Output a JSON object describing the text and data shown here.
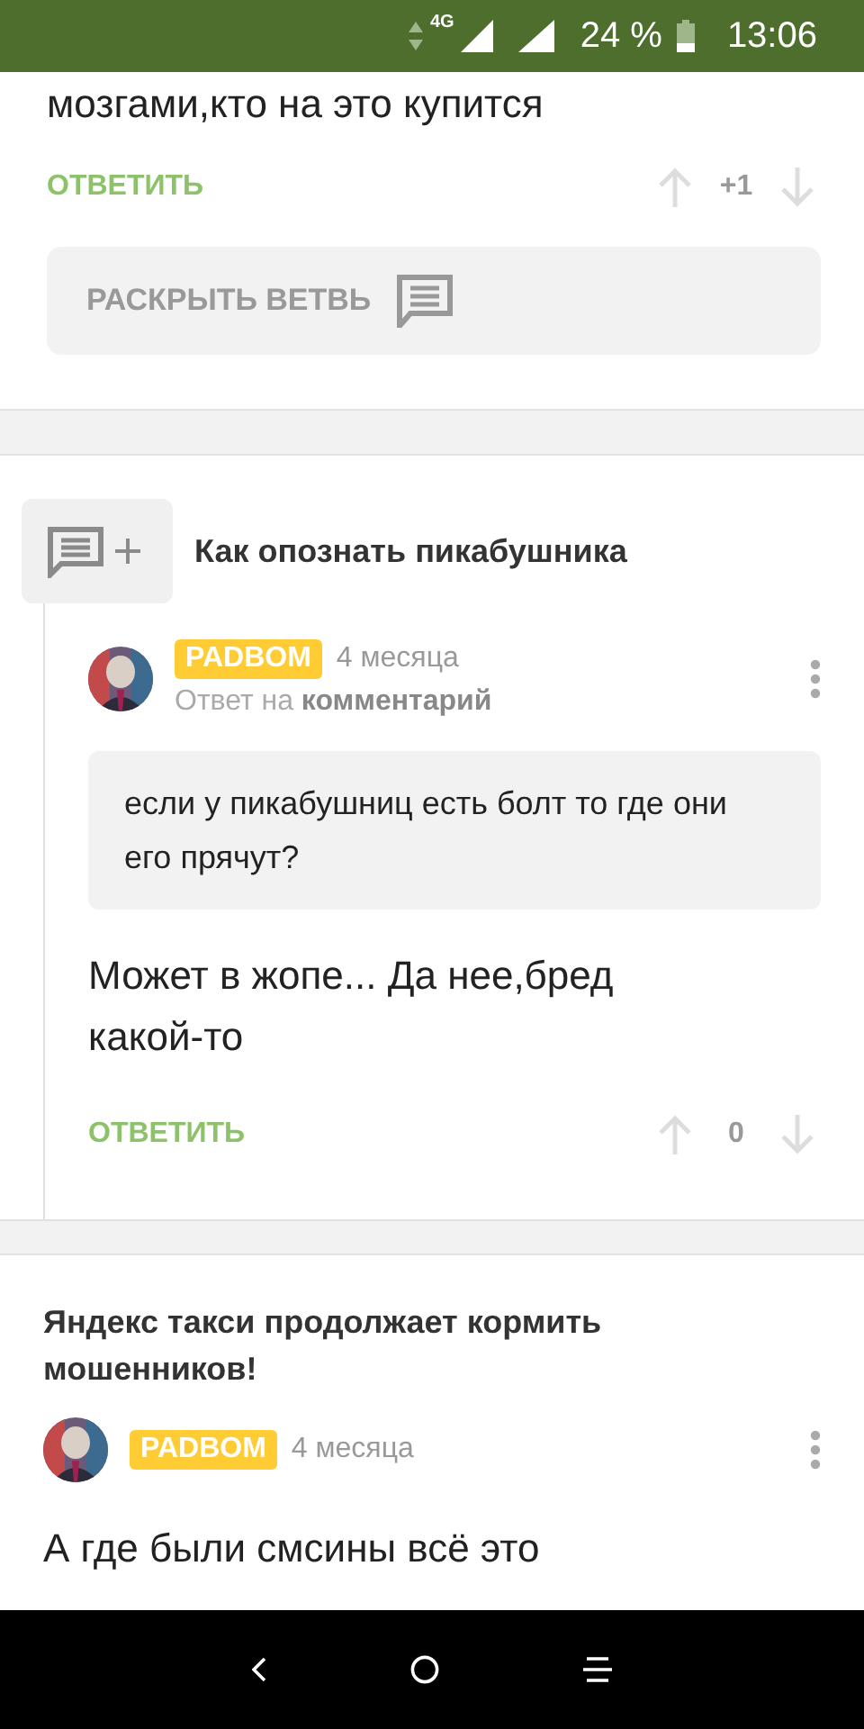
{
  "status_bar": {
    "network": "4G",
    "battery": "24 %",
    "time": "13:06"
  },
  "comment_tail": {
    "text": "мозгами,кто на это купится",
    "reply": "ОТВЕТИТЬ",
    "score": "+1",
    "expand": "РАСКРЫТЬ ВЕТВЬ"
  },
  "posts": [
    {
      "title": "Как опознать пикабушника",
      "title_icon": true,
      "comment": {
        "author": "PADBOM",
        "age": "4 месяца",
        "reply_to": "Ответ на **комментарий**",
        "quote": "если у пикабушниц есть болт то где они его прячут?",
        "text": "Может в жопе... Да нее,бред какой-то",
        "reply": "ОТВЕТИТЬ",
        "score": "0"
      }
    },
    {
      "title": "Яндекс такси продолжает кормить мошенников!",
      "title_icon": false,
      "comment": {
        "author": "PADBOM",
        "age": "4 месяца",
        "text": "А где были смсины всё это"
      }
    }
  ]
}
